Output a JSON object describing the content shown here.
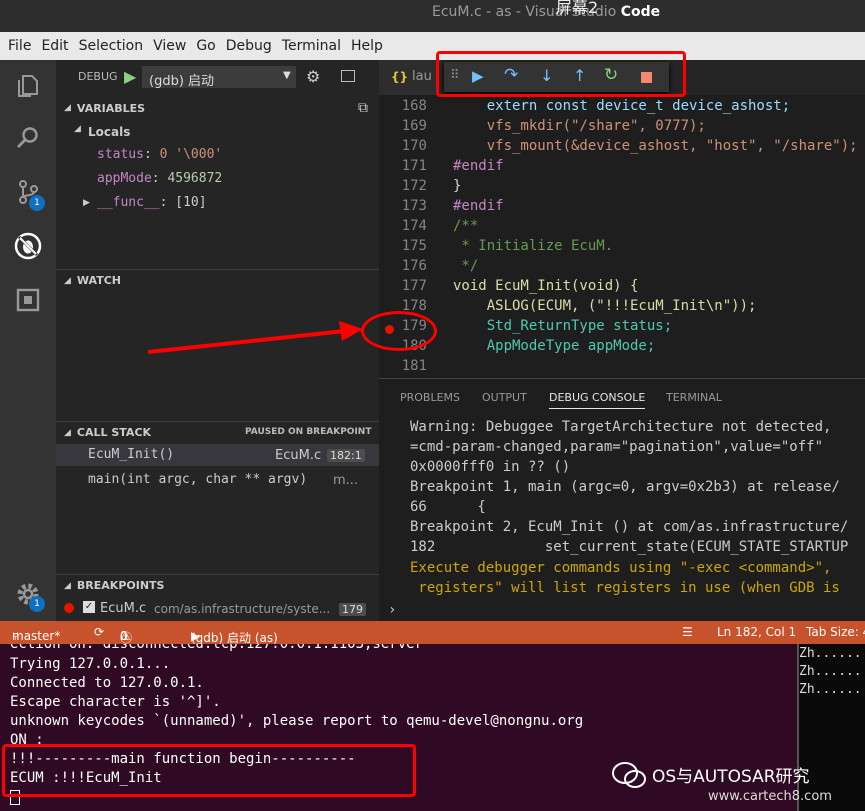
{
  "window": {
    "title_main": "EcuM.c - as - Visual Studio ",
    "title_app": "Code",
    "overlay_text": "屏幕2"
  },
  "menu": [
    "File",
    "Edit",
    "Selection",
    "View",
    "Go",
    "Debug",
    "Terminal",
    "Help"
  ],
  "debug_toolbar": {
    "label": "DEBUG",
    "config": "(gdb) 启动",
    "tab_label": "lau"
  },
  "variables": {
    "header": "VARIABLES",
    "group": "Locals",
    "items": [
      {
        "name": "status",
        "value": "0 '\\000'"
      },
      {
        "name": "appMode",
        "value": "4596872"
      },
      {
        "name": "__func__",
        "value": "[10]"
      }
    ]
  },
  "watch": {
    "header": "WATCH"
  },
  "call_stack": {
    "header": "CALL STACK",
    "state": "PAUSED ON BREAKPOINT",
    "frames": [
      {
        "name": "EcuM_Init()",
        "file": "EcuM.c",
        "pos": "182:1"
      },
      {
        "name": "main(int argc, char ** argv)",
        "file": "m..."
      }
    ]
  },
  "breakpoints": {
    "header": "BREAKPOINTS",
    "items": [
      {
        "file": "EcuM.c",
        "path": "com/as.infrastructure/syste...",
        "line": "179"
      }
    ]
  },
  "activity_badges": {
    "scm": "1",
    "settings": "1"
  },
  "editor": {
    "lines": [
      {
        "n": "168",
        "code": "    extern const device_t device_ashost;"
      },
      {
        "n": "169",
        "code": "    vfs_mkdir(\"/share\", 0777);"
      },
      {
        "n": "170",
        "code": "    vfs_mount(&device_ashost, \"host\", \"/share\");"
      },
      {
        "n": "171",
        "code": "#endif"
      },
      {
        "n": "172",
        "code": "}"
      },
      {
        "n": "173",
        "code": "#endif"
      },
      {
        "n": "174",
        "code": "/**"
      },
      {
        "n": "175",
        "code": " * Initialize EcuM."
      },
      {
        "n": "176",
        "code": " */"
      },
      {
        "n": "177",
        "code": "void EcuM_Init(void) {"
      },
      {
        "n": "178",
        "code": "    ASLOG(ECUM, (\"!!!EcuM_Init\\n\"));"
      },
      {
        "n": "179",
        "code": "    Std_ReturnType status;"
      },
      {
        "n": "180",
        "code": "    AppModeType appMode;"
      },
      {
        "n": "181",
        "code": ""
      }
    ]
  },
  "panel": {
    "tabs": [
      "PROBLEMS",
      "OUTPUT",
      "DEBUG CONSOLE",
      "TERMINAL"
    ],
    "lines": [
      "Warning: Debuggee TargetArchitecture not detected, ",
      "=cmd-param-changed,param=\"pagination\",value=\"off\"",
      "0x0000fff0 in ?? ()",
      "Breakpoint 1, main (argc=0, argv=0x2b3) at release/",
      "66      {",
      "Breakpoint 2, EcuM_Init () at com/as.infrastructure/",
      "182             set_current_state(ECUM_STATE_STARTUP",
      "Execute debugger commands using \"-exec <command>\", ",
      " registers\" will list registers in use (when GDB is"
    ],
    "prompt": "›"
  },
  "statusbar": {
    "branch": "master*",
    "errors": "0",
    "warnings": "0",
    "launch": "(gdb) 启动 (as)",
    "position": "Ln 182, Col 1",
    "tabsize": "Tab Size: 4"
  },
  "terminal": {
    "lines": [
      "ection on: disconnected:tcp:127.0.0.1:1103,server",
      "Trying 127.0.0.1...",
      "Connected to 127.0.0.1.",
      "Escape character is '^]'.",
      "unknown keycodes `(unnamed)', please report to qemu-devel@nongnu.org",
      "ON :",
      "!!!---------main function begin----------",
      "ECUM :!!!EcuM_Init",
      ""
    ],
    "side_lines": [
      "Zh......",
      "Zh......",
      "Zh......"
    ]
  },
  "watermark": {
    "text": "OS与AUTOSAR研究",
    "url": "www.cartech8.com"
  },
  "colors": {
    "status_bar": "#c6532b",
    "accent": "#0e70c0",
    "breakpoint": "#e51400",
    "annotation": "#ff0000",
    "terminal_bg": "#300a24"
  }
}
